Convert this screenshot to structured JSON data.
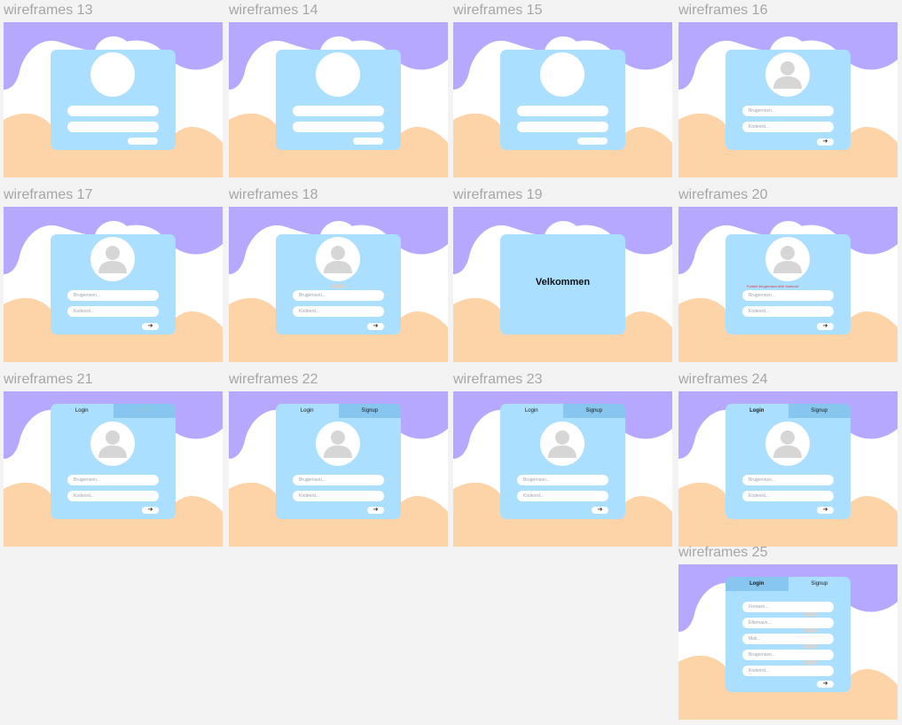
{
  "colors": {
    "page_bg": "#f3f3f3",
    "purple": "#b6a8ff",
    "peach": "#fdd3a8",
    "white": "#ffffff",
    "card": "#aadfff",
    "tab_active": "#aadfff",
    "tab_inactive": "#87c6ee",
    "avatar_figure": "#d6d6d6",
    "title_text": "#a6a6a6",
    "error": "#e0344c"
  },
  "frames": [
    {
      "title": "wireframes 13",
      "variant": "blank"
    },
    {
      "title": "wireframes 14",
      "variant": "blank"
    },
    {
      "title": "wireframes 15",
      "variant": "blank"
    },
    {
      "title": "wireframes 16",
      "variant": "login"
    },
    {
      "title": "wireframes 17",
      "variant": "login"
    },
    {
      "title": "wireframes 18",
      "variant": "login-ghost"
    },
    {
      "title": "wireframes 19",
      "variant": "welcome"
    },
    {
      "title": "wireframes 20",
      "variant": "login-error"
    },
    {
      "title": "wireframes 21",
      "variant": "tabs",
      "signup_faded": true
    },
    {
      "title": "wireframes 22",
      "variant": "tabs"
    },
    {
      "title": "wireframes 23",
      "variant": "tabs"
    },
    {
      "title": "wireframes 24",
      "variant": "tabs",
      "login_bold": true
    },
    {
      "title": "wireframes 25",
      "variant": "signup"
    }
  ],
  "labels": {
    "username_placeholder": "Brugernavn...",
    "password_placeholder": "Kodeord...",
    "welcome": "Velkommen",
    "error": "Forkert brugernavn eller kodeord",
    "tab_login": "Login",
    "tab_signup": "Signup",
    "arrow": "➔",
    "signup_fields": [
      "Fornavn...",
      "Efternavn...",
      "Mail...",
      "Brugernavn...",
      "Kodeord..."
    ]
  }
}
